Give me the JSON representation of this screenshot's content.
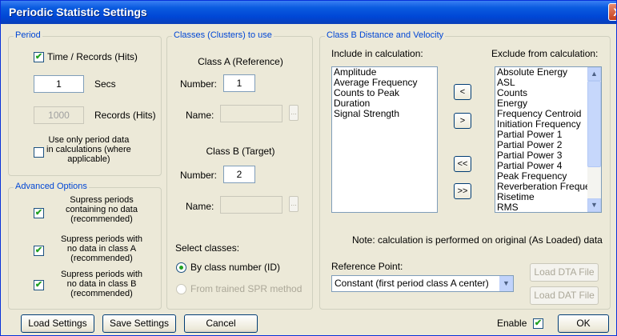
{
  "window": {
    "title": "Periodic Statistic Settings",
    "close_glyph": "X"
  },
  "period": {
    "legend": "Period",
    "time_records_label": "Time / Records (Hits)",
    "time_records_checked": true,
    "secs_value": "1",
    "secs_label": "Secs",
    "records_value": "1000",
    "records_label": "Records (Hits)",
    "use_only_label": "Use only period data\nin calculations (where\napplicable)",
    "use_only_checked": false
  },
  "advanced": {
    "legend": "Advanced Options",
    "options": [
      {
        "label": "Supress periods\ncontaining no data\n(recommended)",
        "checked": true
      },
      {
        "label": "Supress periods with\nno data in class A\n(recommended)",
        "checked": true
      },
      {
        "label": "Supress periods with\nno data in class B\n(recommended)",
        "checked": true
      }
    ]
  },
  "classes": {
    "legend": "Classes (Clusters) to use",
    "class_a_label": "Class A (Reference)",
    "class_a_number_label": "Number:",
    "class_a_number": "1",
    "class_a_name_label": "Name:",
    "class_b_label": "Class B (Target)",
    "class_b_number_label": "Number:",
    "class_b_number": "2",
    "class_b_name_label": "Name:",
    "dots": "...",
    "select_label": "Select classes:",
    "by_number_label": "By class number (ID)",
    "from_spr_label": "From trained SPR method"
  },
  "distance": {
    "legend": "Class B Distance and Velocity",
    "include_label": "Include in calculation:",
    "exclude_label": "Exclude from calculation:",
    "include_items": [
      "Amplitude",
      "Average Frequency",
      "Counts to Peak",
      "Duration",
      "Signal Strength"
    ],
    "exclude_items": [
      "Absolute Energy",
      "ASL",
      "Counts",
      "Energy",
      "Frequency Centroid",
      "Initiation Frequency",
      "Partial Power 1",
      "Partial Power 2",
      "Partial Power 3",
      "Partial Power 4",
      "Peak Frequency",
      "Reverberation Frequency",
      "Risetime",
      "RMS"
    ],
    "btn_left": "<",
    "btn_right": ">",
    "btn_all_left": "<<",
    "btn_all_right": ">>",
    "note": "Note: calculation is performed on original (As Loaded) data",
    "reference_label": "Reference Point:",
    "reference_value": "Constant (first period class A center)",
    "load_dta": "Load DTA File",
    "load_dat": "Load DAT File"
  },
  "footer": {
    "load_settings": "Load Settings",
    "save_settings": "Save Settings",
    "cancel": "Cancel",
    "enable_label": "Enable",
    "enable_checked": true,
    "ok": "OK"
  },
  "colors": {
    "title_bar": "#0a5be0",
    "legend_text": "#0046d5",
    "check_green": "#21a121",
    "close_red": "#c6401e"
  }
}
